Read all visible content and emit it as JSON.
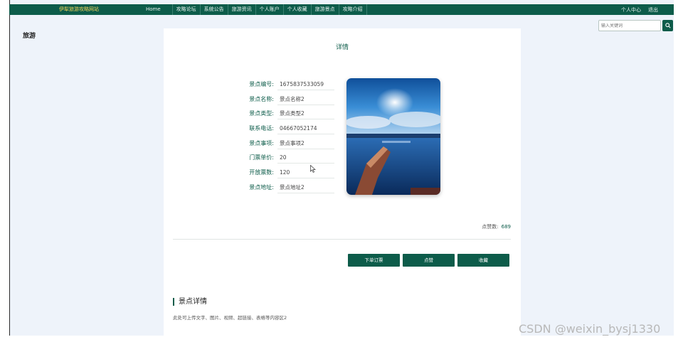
{
  "corner_text": "…",
  "header": {
    "brand": "伊犁旅游攻略网站",
    "nav": [
      "Home",
      "攻略论坛",
      "系统公告",
      "旅游资讯",
      "个人账户",
      "个人收藏",
      "旅游景点",
      "攻略介绍"
    ],
    "right_links": [
      "个人中心",
      "退出"
    ]
  },
  "sidebar": {
    "label": "旅游"
  },
  "search": {
    "placeholder": "输入关键词"
  },
  "panel": {
    "title": "详情",
    "fields": [
      {
        "label": "景点编号:",
        "value": "1675837533059"
      },
      {
        "label": "景点名称:",
        "value": "景点名称2"
      },
      {
        "label": "景点类型:",
        "value": "景点类型2"
      },
      {
        "label": "联系电话:",
        "value": "04667052174"
      },
      {
        "label": "景点事项:",
        "value": "景点事项2"
      },
      {
        "label": "门票单价:",
        "value": "20"
      },
      {
        "label": "开放票数:",
        "value": "120"
      },
      {
        "label": "景点地址:",
        "value": "景点地址2"
      }
    ],
    "likes_label": "点赞数:",
    "likes_count": "689",
    "buttons": {
      "order": "下单订票",
      "like": "点赞",
      "favorite": "收藏"
    },
    "section_title": "景点详情",
    "section_body": "此处可上传文字、图片、视频、超链接、表格等内容区2"
  },
  "watermark": "CSDN @weixin_bysj1330",
  "colors": {
    "primary": "#0d5c4a",
    "brand_text": "#f2d35b",
    "background": "#eef3fa"
  }
}
